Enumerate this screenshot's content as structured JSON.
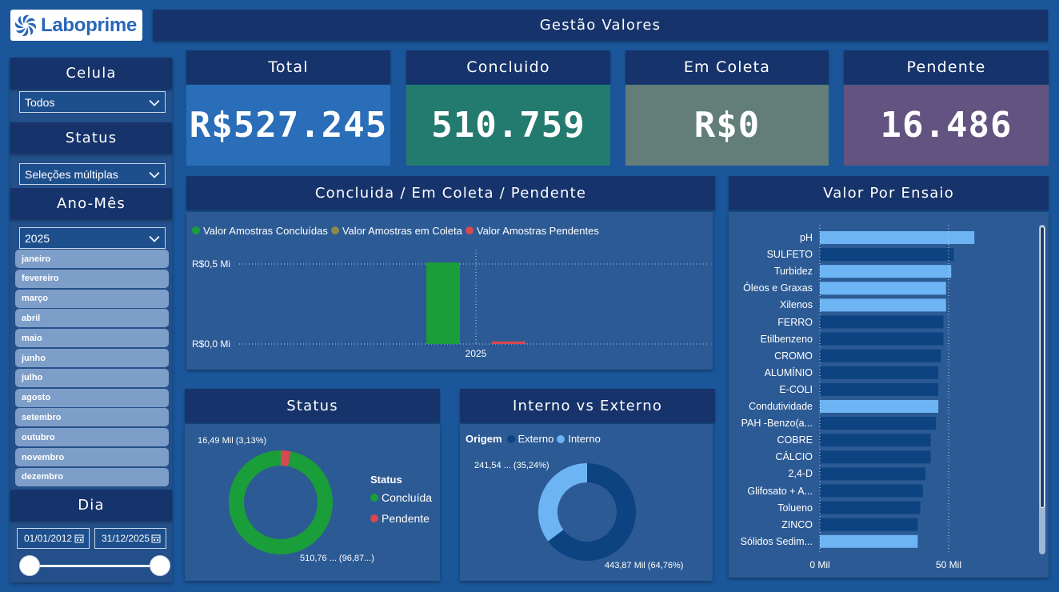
{
  "brand": {
    "name": "Laboprime"
  },
  "header": {
    "title": "Gestão Valores"
  },
  "filters": {
    "celula": {
      "title": "Celula",
      "value": "Todos"
    },
    "status": {
      "title": "Status",
      "value": "Seleções múltiplas"
    },
    "ano_mes": {
      "title": "Ano-Mês",
      "value": "2025",
      "months": [
        "janeiro",
        "fevereiro",
        "março",
        "abril",
        "maio",
        "junho",
        "julho",
        "agosto",
        "setembro",
        "outubro",
        "novembro",
        "dezembro"
      ]
    },
    "dia": {
      "title": "Dia",
      "start": "01/01/2012",
      "end": "31/12/2025",
      "slider_start": 0,
      "slider_end": 1
    }
  },
  "kpis": {
    "total": {
      "label": "Total",
      "value": "R$527.245",
      "color": "#2a6db8"
    },
    "concluido": {
      "label": "Concluido",
      "value": "510.759",
      "color": "#237a6e"
    },
    "em_coleta": {
      "label": "Em Coleta",
      "value": "R$0",
      "color": "#637d78"
    },
    "pendente": {
      "label": "Pendente",
      "value": "16.486",
      "color": "#625380"
    }
  },
  "column_chart": {
    "title": "Concluida / Em Coleta / Pendente",
    "legend": [
      {
        "name": "Valor Amostras Concluídas",
        "color": "#1a9e3a"
      },
      {
        "name": "Valor Amostras em Coleta",
        "color": "#8c8c4a"
      },
      {
        "name": "Valor Amostras Pendentes",
        "color": "#d8484f"
      }
    ],
    "y_ticks": [
      "R$0,5 Mi",
      "R$0,0 Mi"
    ],
    "x_label": "2025"
  },
  "status_chart": {
    "title": "Status",
    "legend_title": "Status",
    "labels": {
      "pendente": "16,49 Mil (3,13%)",
      "concluida": "510,76 ... (96,87...)"
    },
    "legend": [
      {
        "name": "Concluída",
        "color": "#1a9e3a"
      },
      {
        "name": "Pendente",
        "color": "#d8484f"
      }
    ]
  },
  "origin_chart": {
    "title": "Interno vs Externo",
    "legend_title": "Origem",
    "legend": [
      {
        "name": "Externo",
        "color": "#0d4380"
      },
      {
        "name": "Interno",
        "color": "#6db4f5"
      }
    ],
    "labels": {
      "interno": "241,54 ... (35,24%)",
      "externo": "443,87 Mil (64,76%)"
    }
  },
  "bar_panel": {
    "title": "Valor Por Ensaio"
  },
  "chart_data": [
    {
      "type": "bar",
      "categories": [
        "2025"
      ],
      "series": [
        {
          "name": "Valor Amostras Concluídas",
          "values": [
            0.51
          ]
        },
        {
          "name": "Valor Amostras em Coleta",
          "values": [
            0
          ]
        },
        {
          "name": "Valor Amostras Pendentes",
          "values": [
            0.016
          ]
        }
      ],
      "ylabel": "",
      "ylim": [
        0,
        0.5
      ],
      "y_tick_values": [
        0,
        0.5
      ],
      "grid": true,
      "legend_position": "top-left"
    },
    {
      "type": "pie",
      "categories": [
        "Concluída",
        "Pendente"
      ],
      "values": [
        510.76,
        16.49
      ],
      "legend_position": "right"
    },
    {
      "type": "pie",
      "categories": [
        "Externo",
        "Interno"
      ],
      "values": [
        443.87,
        241.54
      ],
      "legend_position": "top-left"
    },
    {
      "type": "bar",
      "orientation": "horizontal",
      "categories": [
        "pH",
        "SULFETO",
        "Turbidez",
        "Óleos e Graxas",
        "Xilenos",
        "FERRO",
        "Etilbenzeno",
        "CROMO",
        "ALUMÍNIO",
        "E-COLI",
        "Condutividade",
        "PAH -Benzo(a...",
        "COBRE",
        "CÁLCIO",
        "2,4-D",
        "Glifosato + A...",
        "Tolueno",
        "ZINCO",
        "Sólidos Sedim..."
      ],
      "values": [
        60,
        52,
        51,
        49,
        49,
        48,
        48,
        47,
        46,
        46,
        46,
        45,
        43,
        43,
        41,
        40,
        39,
        38,
        38
      ],
      "colors": [
        "#6db4f5",
        "#0d4380",
        "#6db4f5",
        "#6db4f5",
        "#6db4f5",
        "#0d4380",
        "#0d4380",
        "#0d4380",
        "#0d4380",
        "#0d4380",
        "#6db4f5",
        "#0d4380",
        "#0d4380",
        "#0d4380",
        "#0d4380",
        "#0d4380",
        "#0d4380",
        "#0d4380",
        "#6db4f5"
      ],
      "x_ticks": [
        "0 Mil",
        "50 Mil"
      ],
      "x_tick_values": [
        0,
        50
      ],
      "xlim": [
        0,
        60
      ]
    }
  ]
}
